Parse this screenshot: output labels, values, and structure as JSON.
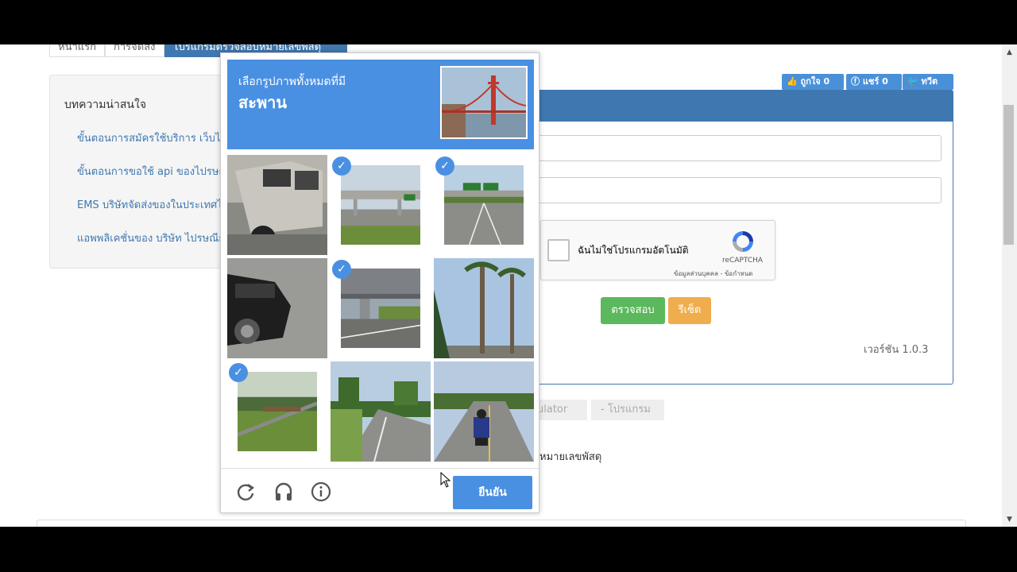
{
  "breadcrumb": [
    "หน้าแรก",
    "การจัดส่ง",
    "โปรแกรมตรวจสอบหมายเลขพัสดุ"
  ],
  "sidebar": {
    "title": "บทความน่าสนใจ",
    "links": [
      "ขั้นตอนการสมัครใช้บริการ เว็บไซต์",
      "ขั้นตอนการขอใช้ api ของไปรษณีย์",
      "EMS บริษัทจัดส่งของในประเทศไทย",
      "แอพพลิเคชั่นของ บริษัท ไปรษณีย์"
    ]
  },
  "social": {
    "like": "ถูกใจ 0",
    "share": "แชร์ 0",
    "tweet": "ทวีต"
  },
  "recaptcha": {
    "label": "ฉันไม่ใช่โปรแกรมอัตโนมัติ",
    "brand": "reCAPTCHA",
    "terms": "ข้อมูลส่วนบุคคล - ข้อกำหนด"
  },
  "buttons": {
    "check": "ตรวจสอบ",
    "reset": "รีเซ็ต"
  },
  "version": "เวอร์ชัน 1.0.3",
  "tags": [
    "ulator",
    "- โปรแกรม"
  ],
  "footline": "หมายเลขพัสดุ",
  "challenge": {
    "instruction": "เลือกรูปภาพทั้งหมดที่มี",
    "object": "สะพาน",
    "verify": "ยืนยัน",
    "tiles": [
      {
        "scene": "van",
        "selected": false
      },
      {
        "scene": "overpass",
        "selected": true
      },
      {
        "scene": "highway-sign",
        "selected": true
      },
      {
        "scene": "car",
        "selected": false
      },
      {
        "scene": "underpass",
        "selected": true
      },
      {
        "scene": "palm-trees",
        "selected": false
      },
      {
        "scene": "footbridge",
        "selected": true
      },
      {
        "scene": "road-trees",
        "selected": false
      },
      {
        "scene": "motorcycle-road",
        "selected": false
      }
    ]
  },
  "colors": {
    "accent": "#4a90e2",
    "panel": "#3f78b0",
    "green": "#5cb85c",
    "orange": "#f0ad4e"
  }
}
